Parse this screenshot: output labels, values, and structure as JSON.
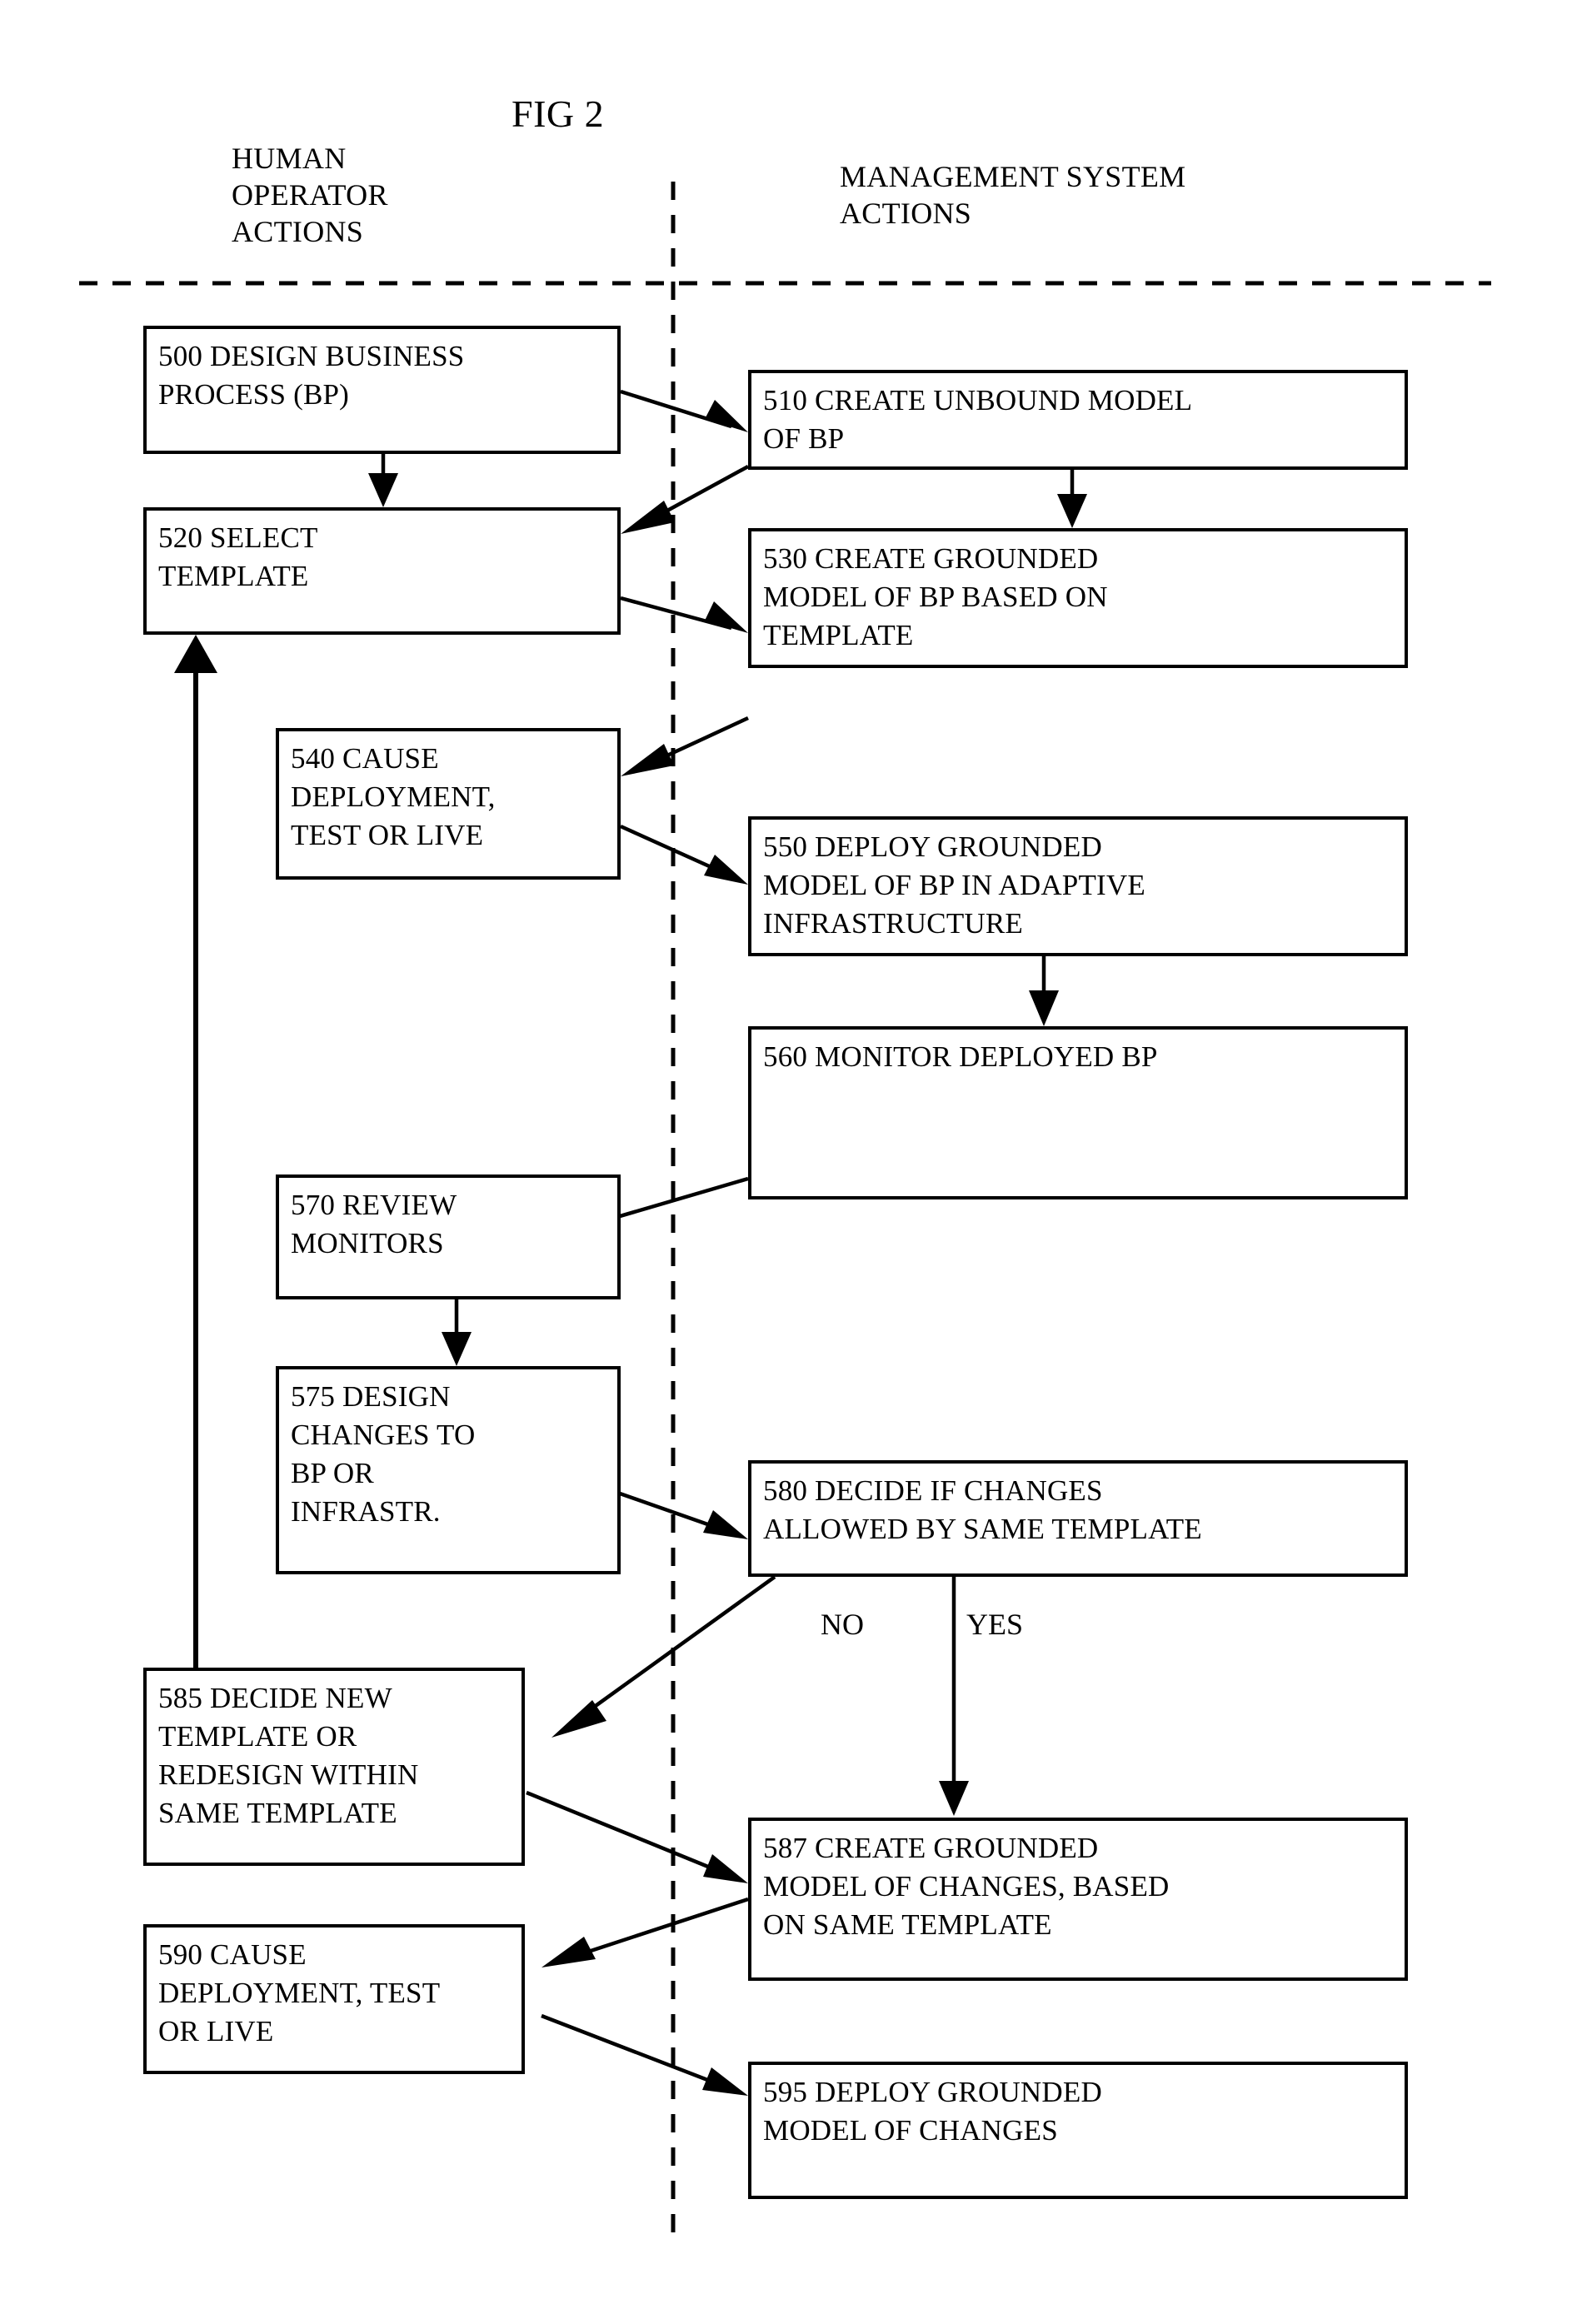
{
  "figure": {
    "title": "FIG 2"
  },
  "swimlanes": [
    {
      "id": "human-operator",
      "lines": [
        "HUMAN",
        "OPERATOR",
        "ACTIONS"
      ]
    },
    {
      "id": "management-system",
      "lines": [
        "MANAGEMENT SYSTEM",
        "ACTIONS"
      ]
    }
  ],
  "boxes": [
    {
      "ref": "500",
      "lane": "human-operator",
      "lines": [
        "500 DESIGN BUSINESS",
        "PROCESS (BP)"
      ]
    },
    {
      "ref": "510",
      "lane": "management-system",
      "lines": [
        "510 CREATE UNBOUND MODEL",
        "OF BP"
      ]
    },
    {
      "ref": "520",
      "lane": "human-operator",
      "lines": [
        "520 SELECT",
        "TEMPLATE"
      ]
    },
    {
      "ref": "530",
      "lane": "management-system",
      "lines": [
        "530 CREATE GROUNDED",
        "MODEL OF BP BASED ON",
        "TEMPLATE"
      ]
    },
    {
      "ref": "540",
      "lane": "human-operator",
      "lines": [
        "540 CAUSE",
        "DEPLOYMENT,",
        "TEST OR LIVE"
      ]
    },
    {
      "ref": "550",
      "lane": "management-system",
      "lines": [
        "550 DEPLOY GROUNDED",
        "MODEL OF BP IN ADAPTIVE",
        "INFRASTRUCTURE"
      ]
    },
    {
      "ref": "560",
      "lane": "management-system",
      "lines": [
        "560 MONITOR DEPLOYED BP"
      ]
    },
    {
      "ref": "570",
      "lane": "human-operator",
      "lines": [
        "570 REVIEW",
        "MONITORS"
      ]
    },
    {
      "ref": "575",
      "lane": "human-operator",
      "lines": [
        "575 DESIGN",
        "CHANGES TO",
        "BP OR",
        "INFRASTR."
      ]
    },
    {
      "ref": "580",
      "lane": "management-system",
      "lines": [
        "580 DECIDE IF CHANGES",
        "ALLOWED BY SAME TEMPLATE"
      ]
    },
    {
      "ref": "585",
      "lane": "human-operator",
      "lines": [
        "585 DECIDE NEW",
        "TEMPLATE OR",
        "REDESIGN WITHIN",
        "SAME TEMPLATE"
      ]
    },
    {
      "ref": "587",
      "lane": "management-system",
      "lines": [
        "587 CREATE GROUNDED",
        "MODEL OF CHANGES, BASED",
        "ON SAME TEMPLATE"
      ]
    },
    {
      "ref": "590",
      "lane": "human-operator",
      "lines": [
        "590 CAUSE",
        "DEPLOYMENT, TEST",
        "OR LIVE"
      ]
    },
    {
      "ref": "595",
      "lane": "management-system",
      "lines": [
        "595 DEPLOY GROUNDED",
        "MODEL OF CHANGES"
      ]
    }
  ],
  "branch_labels": [
    {
      "id": "no",
      "text": "NO",
      "from": "580",
      "to": "585"
    },
    {
      "id": "yes",
      "text": "YES",
      "from": "580",
      "to": "587"
    }
  ],
  "colors": {
    "ink": "#000000",
    "paper": "#ffffff"
  }
}
